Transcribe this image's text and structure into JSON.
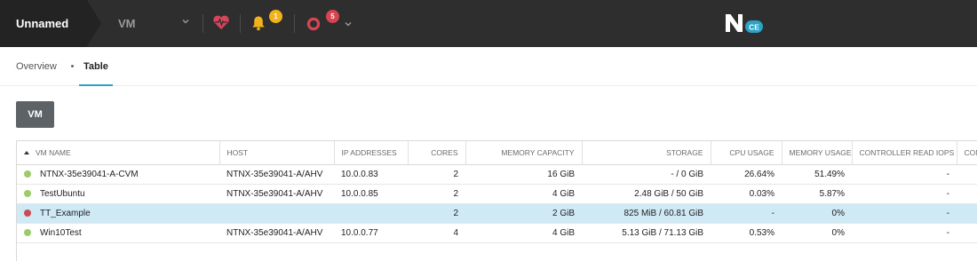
{
  "topbar": {
    "cluster_name": "Unnamed",
    "entity_menu_label": "VM",
    "alerts_count": "1",
    "critical_count": "5",
    "logo_letter": "N",
    "logo_badge": "CE"
  },
  "subnav": {
    "overview_label": "Overview",
    "table_label": "Table"
  },
  "actions": {
    "vm_button_label": "VM"
  },
  "table": {
    "columns": [
      "VM NAME",
      "HOST",
      "IP ADDRESSES",
      "CORES",
      "MEMORY CAPACITY",
      "STORAGE",
      "CPU USAGE",
      "MEMORY USAGE",
      "CONTROLLER READ IOPS",
      "CONTI"
    ],
    "rows": [
      {
        "status": "on",
        "name": "NTNX-35e39041-A-CVM",
        "host": "NTNX-35e39041-A/AHV",
        "ip": "10.0.0.83",
        "cores": "2",
        "memory": "16 GiB",
        "storage": "- / 0 GiB",
        "cpu": "26.64%",
        "mem_usage": "51.49%",
        "read_iops": "-"
      },
      {
        "status": "on",
        "name": "TestUbuntu",
        "host": "NTNX-35e39041-A/AHV",
        "ip": "10.0.0.85",
        "cores": "2",
        "memory": "4 GiB",
        "storage": "2.48 GiB / 50 GiB",
        "cpu": "0.03%",
        "mem_usage": "5.87%",
        "read_iops": "-"
      },
      {
        "status": "off",
        "name": "TT_Example",
        "host": "",
        "ip": "",
        "cores": "2",
        "memory": "2 GiB",
        "storage": "825 MiB / 60.81 GiB",
        "cpu": "-",
        "mem_usage": "0%",
        "read_iops": "-"
      },
      {
        "status": "on",
        "name": "Win10Test",
        "host": "NTNX-35e39041-A/AHV",
        "ip": "10.0.0.77",
        "cores": "4",
        "memory": "4 GiB",
        "storage": "5.13 GiB / 71.13 GiB",
        "cpu": "0.53%",
        "mem_usage": "0%",
        "read_iops": "-"
      }
    ]
  },
  "colors": {
    "status_on": "#9ccb6a",
    "status_off": "#c94b55",
    "selected_row": "#cfe9f5",
    "accent": "#2aa3c7",
    "alert_badge": "#f2b31a",
    "critical_badge": "#d64550"
  }
}
